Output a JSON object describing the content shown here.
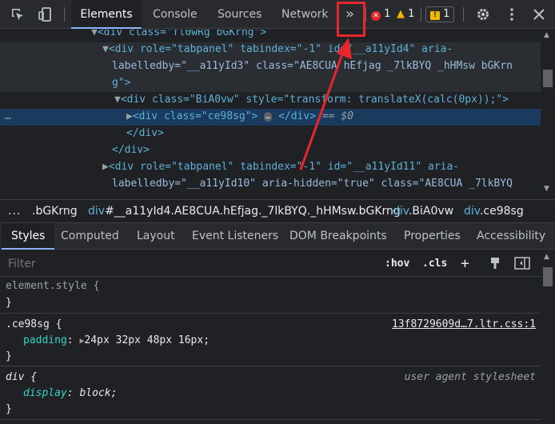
{
  "toolbar": {
    "tabs": [
      "Elements",
      "Console",
      "Sources",
      "Network"
    ],
    "more_tabs": "»",
    "errors_count": "1",
    "warnings_count": "1",
    "issues_count": "1",
    "colors": {
      "error": "#e8262b",
      "warning": "#f2b600",
      "issue": "#f2b600",
      "accent": "#8ab4f8"
    }
  },
  "tree": {
    "lines": [
      {
        "tag": "div",
        "text": "<div class=\"fl0wRg bGKrng\">"
      },
      {
        "text": "<div role=\"tabpanel\" tabindex=\"-1\" id=\"__a11yId4\" aria-"
      },
      {
        "text": "labelledby=\"__a11yId3\" class=\"AE8CUA hEfjag _7lkBYQ _hHMsw bGKrn"
      },
      {
        "text": "g\">"
      },
      {
        "text": "<div class=\"BiA0vw\" style=\"transform: translateX(calc(0px));\">"
      },
      {
        "text": "<div class=\"ce98sg\">"
      },
      {
        "text": "</div>"
      },
      {
        "text": "</div>"
      },
      {
        "text": "<div role=\"tabpanel\" tabindex=\"-1\" id=\"__a11yId11\" aria-"
      },
      {
        "text": "labelledby=\"__a11yId10\" aria-hidden=\"true\" class=\"AE8CUA _7lkBYQ"
      }
    ],
    "selected_suffix": " == $0",
    "ellipsis": "…"
  },
  "breadcrumbs": [
    {
      "prefix": "...",
      "tag": "",
      "text": ".bGKrng"
    },
    {
      "tag": "div",
      "text": "#__a11yId4.AE8CUA.hEfjag._7lkBYQ._hHMsw.bGKrng"
    },
    {
      "tag": "div",
      "text": ".BiA0vw"
    },
    {
      "tag": "div",
      "text": ".ce98sg"
    }
  ],
  "style_tabs": [
    "Styles",
    "Computed",
    "Layout",
    "Event Listeners",
    "DOM Breakpoints",
    "Properties",
    "Accessibility"
  ],
  "filter": {
    "placeholder": "Filter",
    "hov": ":hov",
    "cls": ".cls",
    "plus": "+"
  },
  "rules": [
    {
      "selector": "element.style {",
      "close": "}"
    },
    {
      "selector": ".ce98sg {",
      "source": "13f8729609d…7.ltr.css:1",
      "prop": "padding",
      "value": "24px 32px 48px 16px;",
      "close": "}"
    },
    {
      "selector": "div {",
      "source": "user agent stylesheet",
      "prop": "display",
      "value": "block;",
      "close": "}"
    }
  ]
}
